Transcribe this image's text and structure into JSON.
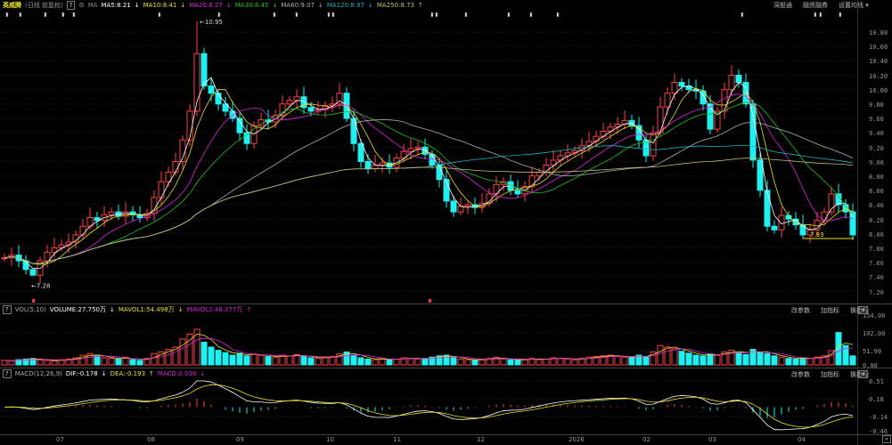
{
  "header": {
    "stock_name": "英威腾",
    "mode": "(日线 前复权)",
    "help": "?",
    "ma_label": "MA",
    "ma": [
      {
        "label": "MA5:8.21",
        "arrow": "↓",
        "color": "#ffffff"
      },
      {
        "label": "MA10:8.41",
        "arrow": "↓",
        "color": "#e8e020"
      },
      {
        "label": "MA20:8.27",
        "arrow": "↓",
        "color": "#e020e0"
      },
      {
        "label": "MA30:8.45",
        "arrow": "↓",
        "color": "#20c020"
      },
      {
        "label": "MA60:9.07",
        "arrow": "↓",
        "color": "#b0b0b0"
      },
      {
        "label": "MA120:8.97",
        "arrow": "↓",
        "color": "#20b0c0"
      },
      {
        "label": "MA250:8.73",
        "arrow": "↑",
        "color": "#c8c070"
      }
    ],
    "tools": [
      "深股通",
      "融资融券",
      "设置均线 ▾"
    ]
  },
  "annotations": {
    "high": "←10.95",
    "low": "←7.28",
    "last_low": "7.93"
  },
  "price_axis": [
    "10.80",
    "10.60",
    "10.40",
    "10.20",
    "10.00",
    "9.80",
    "9.60",
    "9.40",
    "9.20",
    "9.00",
    "8.80",
    "8.60",
    "8.40",
    "8.20",
    "8.00",
    "7.80",
    "7.60",
    "7.40",
    "7.20"
  ],
  "volume": {
    "title": "VOL(5,10)",
    "volume_label": "VOLUME:27.750万",
    "mavol1": "MAVOL1:54.498万",
    "mavol2": "MAVOL2:46.377万",
    "tools": [
      "改参数",
      "加指标",
      "换指标"
    ],
    "close": "×",
    "axis": [
      "154.00",
      "102.00",
      "51.90",
      "0.00"
    ]
  },
  "macd": {
    "title": "MACD(12,26,9)",
    "dif": "DIF:-0.178",
    "dea": "DEA:-0.193",
    "macd": "MACD:0.030",
    "tools": [
      "改参数",
      "加指标",
      "换指标"
    ],
    "close": "×",
    "axis": [
      "0.51",
      "0.18",
      "-0.14",
      "-0.46"
    ]
  },
  "months": [
    "07",
    "08",
    "09",
    "10",
    "11",
    "12",
    "2026",
    "02",
    "03",
    "04"
  ],
  "nav_button": "»",
  "colors": {
    "up": "#ff4040",
    "down": "#20f0f0",
    "grid": "#333333"
  },
  "chart_data": {
    "type": "candlestick",
    "ylim": [
      7.2,
      10.8
    ],
    "volume_ylim": [
      0,
      154
    ],
    "macd_ylim": [
      -0.46,
      0.51
    ],
    "close": [
      7.66,
      7.7,
      7.62,
      7.5,
      7.42,
      7.62,
      7.74,
      7.8,
      7.84,
      7.88,
      7.98,
      8.1,
      8.22,
      8.18,
      8.26,
      8.3,
      8.24,
      8.3,
      8.26,
      8.22,
      8.28,
      8.5,
      8.72,
      8.85,
      9.0,
      9.3,
      9.7,
      10.5,
      10.05,
      9.95,
      9.8,
      9.7,
      9.6,
      9.4,
      9.25,
      9.5,
      9.58,
      9.55,
      9.64,
      9.8,
      9.85,
      9.9,
      9.75,
      9.7,
      9.72,
      9.78,
      9.8,
      9.95,
      9.6,
      9.25,
      9.0,
      8.9,
      8.95,
      8.98,
      8.92,
      9.05,
      9.14,
      9.18,
      9.2,
      9.1,
      8.95,
      8.75,
      8.45,
      8.3,
      8.38,
      8.4,
      8.36,
      8.42,
      8.55,
      8.68,
      8.72,
      8.6,
      8.55,
      8.65,
      8.8,
      8.85,
      8.95,
      9.02,
      9.08,
      9.12,
      9.15,
      9.22,
      9.28,
      9.35,
      9.42,
      9.48,
      9.52,
      9.57,
      9.5,
      9.3,
      9.08,
      9.4,
      9.76,
      9.95,
      10.1,
      10.05,
      10.0,
      9.98,
      9.8,
      9.45,
      9.7,
      10.0,
      10.2,
      10.1,
      9.8,
      9.02,
      8.6,
      8.1,
      8.05,
      8.25,
      8.2,
      8.12,
      7.98,
      8.05,
      8.18,
      8.3,
      8.55,
      8.4,
      8.3,
      7.98
    ],
    "volume": [
      14,
      12,
      16,
      18,
      20,
      15,
      14,
      12,
      16,
      18,
      22,
      30,
      35,
      28,
      22,
      20,
      18,
      24,
      16,
      14,
      20,
      35,
      40,
      48,
      55,
      80,
      95,
      110,
      70,
      55,
      45,
      38,
      30,
      36,
      28,
      34,
      30,
      26,
      24,
      30,
      28,
      32,
      26,
      22,
      20,
      24,
      26,
      34,
      40,
      30,
      22,
      18,
      16,
      20,
      15,
      18,
      22,
      20,
      18,
      20,
      24,
      28,
      30,
      22,
      18,
      16,
      14,
      18,
      20,
      24,
      18,
      16,
      14,
      18,
      20,
      16,
      18,
      22,
      20,
      18,
      16,
      20,
      24,
      26,
      28,
      30,
      26,
      24,
      22,
      30,
      26,
      40,
      60,
      55,
      50,
      42,
      36,
      30,
      28,
      34,
      30,
      40,
      45,
      38,
      32,
      48,
      40,
      35,
      28,
      24,
      20,
      18,
      22,
      20,
      24,
      28,
      44,
      100,
      60,
      28
    ]
  }
}
